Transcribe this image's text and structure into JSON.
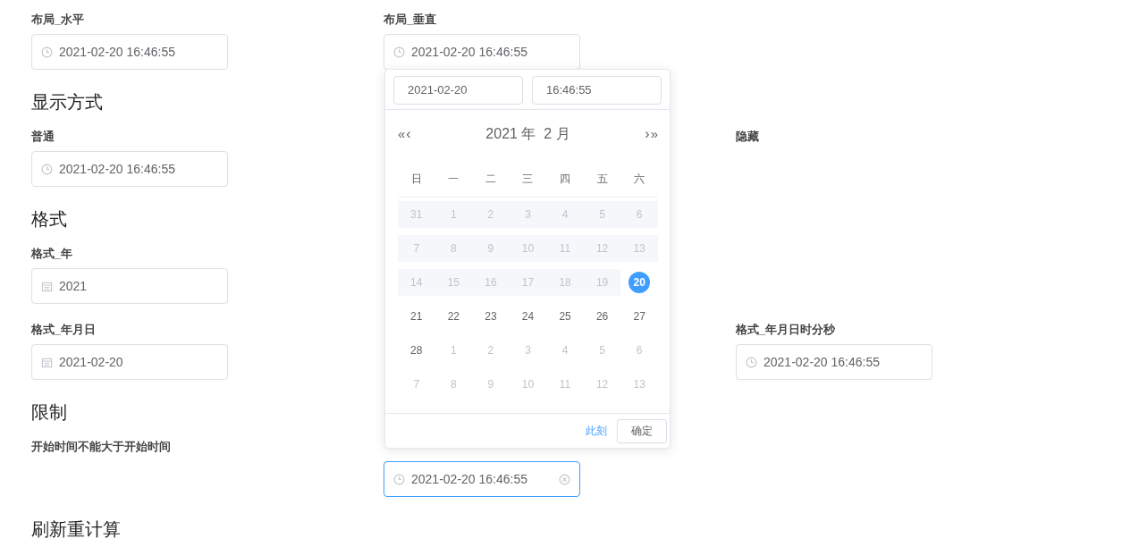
{
  "form": [
    {
      "kind": "fields",
      "cells": [
        {
          "label": "布局_水平",
          "field": {
            "kind": "clock",
            "value": "2021-02-20 16:46:55",
            "focused": false,
            "clearable": false
          }
        },
        {
          "label": "布局_垂直",
          "field": {
            "kind": "clock",
            "value": "2021-02-20 16:46:55",
            "focused": false,
            "clearable": false
          }
        },
        null
      ]
    },
    {
      "kind": "heading",
      "text": "显示方式"
    },
    {
      "kind": "fields",
      "cells": [
        {
          "label": "普通",
          "field": {
            "kind": "clock",
            "value": "2021-02-20 16:46:55",
            "focused": false,
            "clearable": false
          }
        },
        null,
        {
          "label": "隐藏"
        }
      ]
    },
    {
      "kind": "heading",
      "text": "格式"
    },
    {
      "kind": "fields",
      "cells": [
        {
          "label": "格式_年",
          "field": {
            "kind": "calendar",
            "value": "2021",
            "focused": false,
            "clearable": false
          }
        },
        null,
        null
      ]
    },
    {
      "kind": "fields",
      "cells": [
        {
          "label": "格式_年月日",
          "field": {
            "kind": "calendar",
            "value": "2021-02-20",
            "focused": false,
            "clearable": false
          }
        },
        null,
        {
          "label": "格式_年月日时分秒",
          "field": {
            "kind": "clock",
            "value": "2021-02-20 16:46:55",
            "focused": false,
            "clearable": false
          }
        }
      ]
    },
    {
      "kind": "heading",
      "text": "限制"
    },
    {
      "kind": "fields",
      "cells": [
        {
          "label": "开始时间不能大于开始时间"
        },
        {
          "field": {
            "kind": "clock",
            "value": "2021-02-20 16:46:55",
            "focused": true,
            "clearable": true
          }
        },
        null
      ]
    },
    {
      "kind": "heading",
      "text": "刷新重计算"
    }
  ],
  "picker": {
    "date_input": "2021-02-20",
    "time_input": "16:46:55",
    "prev_year": "«",
    "prev_month": "‹",
    "title": "2021 年  2 月",
    "next_month": "›",
    "next_year": "»",
    "weekdays": [
      "日",
      "一",
      "二",
      "三",
      "四",
      "五",
      "六"
    ],
    "weeks": [
      [
        {
          "day": "31",
          "kind": "disabled",
          "selected": false
        },
        {
          "day": "1",
          "kind": "disabled",
          "selected": false
        },
        {
          "day": "2",
          "kind": "disabled",
          "selected": false
        },
        {
          "day": "3",
          "kind": "disabled",
          "selected": false
        },
        {
          "day": "4",
          "kind": "disabled",
          "selected": false
        },
        {
          "day": "5",
          "kind": "disabled",
          "selected": false
        },
        {
          "day": "6",
          "kind": "disabled",
          "selected": false
        }
      ],
      [
        {
          "day": "7",
          "kind": "disabled",
          "selected": false
        },
        {
          "day": "8",
          "kind": "disabled",
          "selected": false
        },
        {
          "day": "9",
          "kind": "disabled",
          "selected": false
        },
        {
          "day": "10",
          "kind": "disabled",
          "selected": false
        },
        {
          "day": "11",
          "kind": "disabled",
          "selected": false
        },
        {
          "day": "12",
          "kind": "disabled",
          "selected": false
        },
        {
          "day": "13",
          "kind": "disabled",
          "selected": false
        }
      ],
      [
        {
          "day": "14",
          "kind": "disabled",
          "selected": false
        },
        {
          "day": "15",
          "kind": "disabled",
          "selected": false
        },
        {
          "day": "16",
          "kind": "disabled",
          "selected": false
        },
        {
          "day": "17",
          "kind": "disabled",
          "selected": false
        },
        {
          "day": "18",
          "kind": "disabled",
          "selected": false
        },
        {
          "day": "19",
          "kind": "disabled",
          "selected": false
        },
        {
          "day": "20",
          "kind": "current",
          "selected": true
        }
      ],
      [
        {
          "day": "21",
          "kind": "current",
          "selected": false
        },
        {
          "day": "22",
          "kind": "current",
          "selected": false
        },
        {
          "day": "23",
          "kind": "current",
          "selected": false
        },
        {
          "day": "24",
          "kind": "current",
          "selected": false
        },
        {
          "day": "25",
          "kind": "current",
          "selected": false
        },
        {
          "day": "26",
          "kind": "current",
          "selected": false
        },
        {
          "day": "27",
          "kind": "current",
          "selected": false
        }
      ],
      [
        {
          "day": "28",
          "kind": "current",
          "selected": false
        },
        {
          "day": "1",
          "kind": "other",
          "selected": false
        },
        {
          "day": "2",
          "kind": "other",
          "selected": false
        },
        {
          "day": "3",
          "kind": "other",
          "selected": false
        },
        {
          "day": "4",
          "kind": "other",
          "selected": false
        },
        {
          "day": "5",
          "kind": "other",
          "selected": false
        },
        {
          "day": "6",
          "kind": "other",
          "selected": false
        }
      ],
      [
        {
          "day": "7",
          "kind": "other",
          "selected": false
        },
        {
          "day": "8",
          "kind": "other",
          "selected": false
        },
        {
          "day": "9",
          "kind": "other",
          "selected": false
        },
        {
          "day": "10",
          "kind": "other",
          "selected": false
        },
        {
          "day": "11",
          "kind": "other",
          "selected": false
        },
        {
          "day": "12",
          "kind": "other",
          "selected": false
        },
        {
          "day": "13",
          "kind": "other",
          "selected": false
        }
      ]
    ],
    "now_link": "此刻",
    "confirm_button": "确定"
  }
}
